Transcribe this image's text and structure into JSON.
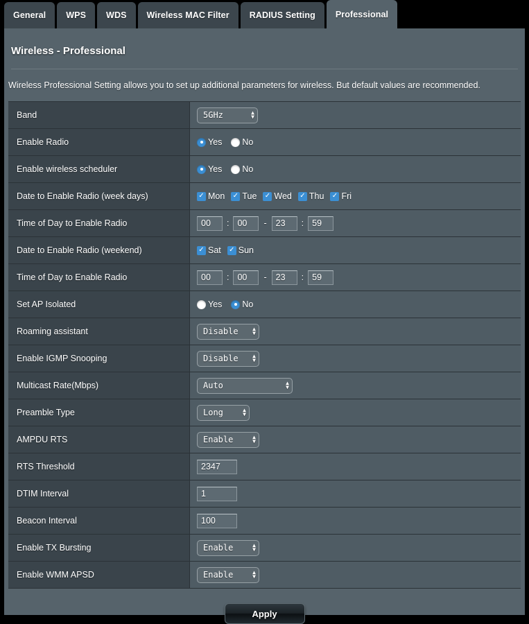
{
  "tabs": [
    {
      "label": "General",
      "active": false
    },
    {
      "label": "WPS",
      "active": false
    },
    {
      "label": "WDS",
      "active": false
    },
    {
      "label": "Wireless MAC Filter",
      "active": false
    },
    {
      "label": "RADIUS Setting",
      "active": false
    },
    {
      "label": "Professional",
      "active": true
    }
  ],
  "page": {
    "title": "Wireless - Professional",
    "description": "Wireless Professional Setting allows you to set up additional parameters for wireless. But default values are recommended."
  },
  "colors": {
    "accent_blue": "#3b8fd4",
    "panel_bg": "#56636b",
    "label_cell_bg": "#3a444b",
    "value_cell_bg": "#4f5c64",
    "tab_inactive": "#3c464d",
    "border": "#2b3237",
    "text": "#ffffff"
  },
  "rows": {
    "band": {
      "label": "Band",
      "value": "5GHz"
    },
    "enable_radio": {
      "label": "Enable Radio",
      "yes_label": "Yes",
      "no_label": "No",
      "selected": "Yes"
    },
    "enable_wireless_scheduler": {
      "label": "Enable wireless scheduler",
      "yes_label": "Yes",
      "no_label": "No",
      "selected": "Yes"
    },
    "date_weekdays": {
      "label": "Date to Enable Radio (week days)",
      "days": [
        {
          "label": "Mon",
          "checked": true
        },
        {
          "label": "Tue",
          "checked": true
        },
        {
          "label": "Wed",
          "checked": true
        },
        {
          "label": "Thu",
          "checked": true
        },
        {
          "label": "Fri",
          "checked": true
        }
      ]
    },
    "time_weekdays": {
      "label": "Time of Day to Enable Radio",
      "start_hour": "00",
      "start_min": "00",
      "end_hour": "23",
      "end_min": "59",
      "colon": ":",
      "dash": "-"
    },
    "date_weekend": {
      "label": "Date to Enable Radio (weekend)",
      "days": [
        {
          "label": "Sat",
          "checked": true
        },
        {
          "label": "Sun",
          "checked": true
        }
      ]
    },
    "time_weekend": {
      "label": "Time of Day to Enable Radio",
      "start_hour": "00",
      "start_min": "00",
      "end_hour": "23",
      "end_min": "59",
      "colon": ":",
      "dash": "-"
    },
    "set_ap_isolated": {
      "label": "Set AP Isolated",
      "yes_label": "Yes",
      "no_label": "No",
      "selected": "No"
    },
    "roaming_assistant": {
      "label": "Roaming assistant",
      "value": "Disable"
    },
    "igmp_snooping": {
      "label": "Enable IGMP Snooping",
      "value": "Disable"
    },
    "multicast_rate": {
      "label": "Multicast Rate(Mbps)",
      "value": "Auto"
    },
    "preamble_type": {
      "label": "Preamble Type",
      "value": "Long"
    },
    "ampdu_rts": {
      "label": "AMPDU RTS",
      "value": "Enable"
    },
    "rts_threshold": {
      "label": "RTS Threshold",
      "value": "2347"
    },
    "dtim_interval": {
      "label": "DTIM Interval",
      "value": "1"
    },
    "beacon_interval": {
      "label": "Beacon Interval",
      "value": "100"
    },
    "tx_bursting": {
      "label": "Enable TX Bursting",
      "value": "Enable"
    },
    "wmm_apsd": {
      "label": "Enable WMM APSD",
      "value": "Enable"
    }
  },
  "footer": {
    "apply_label": "Apply"
  },
  "glyphs": {
    "check": "✓",
    "arrow_up": "▲",
    "arrow_down": "▼"
  }
}
